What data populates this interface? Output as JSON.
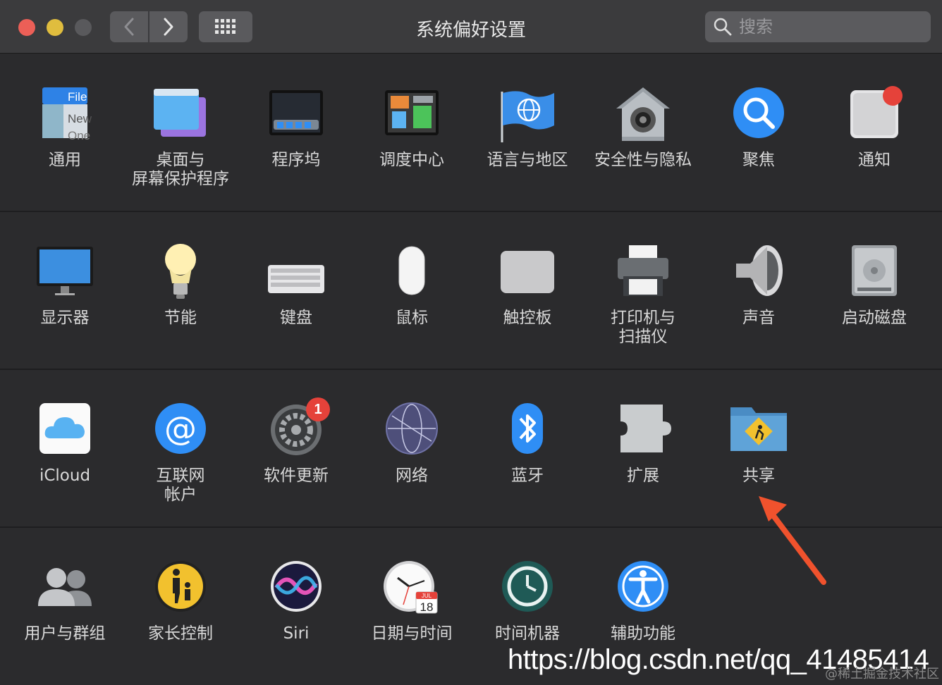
{
  "window": {
    "title": "系统偏好设置"
  },
  "search": {
    "placeholder": "搜索"
  },
  "rows": [
    [
      {
        "label": "通用",
        "icon": "general-icon"
      },
      {
        "label": "桌面与\n屏幕保护程序",
        "icon": "desktop-screensaver-icon"
      },
      {
        "label": "程序坞",
        "icon": "dock-icon"
      },
      {
        "label": "调度中心",
        "icon": "mission-control-icon"
      },
      {
        "label": "语言与地区",
        "icon": "language-region-icon"
      },
      {
        "label": "安全性与隐私",
        "icon": "security-privacy-icon"
      },
      {
        "label": "聚焦",
        "icon": "spotlight-icon"
      },
      {
        "label": "通知",
        "icon": "notifications-icon"
      }
    ],
    [
      {
        "label": "显示器",
        "icon": "displays-icon"
      },
      {
        "label": "节能",
        "icon": "energy-saver-icon"
      },
      {
        "label": "键盘",
        "icon": "keyboard-icon"
      },
      {
        "label": "鼠标",
        "icon": "mouse-icon"
      },
      {
        "label": "触控板",
        "icon": "trackpad-icon"
      },
      {
        "label": "打印机与\n扫描仪",
        "icon": "printers-scanners-icon"
      },
      {
        "label": "声音",
        "icon": "sound-icon"
      },
      {
        "label": "启动磁盘",
        "icon": "startup-disk-icon"
      }
    ],
    [
      {
        "label": "iCloud",
        "icon": "icloud-icon"
      },
      {
        "label": "互联网\n帐户",
        "icon": "internet-accounts-icon"
      },
      {
        "label": "软件更新",
        "icon": "software-update-icon",
        "badge": "1"
      },
      {
        "label": "网络",
        "icon": "network-icon"
      },
      {
        "label": "蓝牙",
        "icon": "bluetooth-icon"
      },
      {
        "label": "扩展",
        "icon": "extensions-icon"
      },
      {
        "label": "共享",
        "icon": "sharing-icon"
      }
    ],
    [
      {
        "label": "用户与群组",
        "icon": "users-groups-icon"
      },
      {
        "label": "家长控制",
        "icon": "parental-controls-icon"
      },
      {
        "label": "Siri",
        "icon": "siri-icon"
      },
      {
        "label": "日期与时间",
        "icon": "date-time-icon"
      },
      {
        "label": "时间机器",
        "icon": "time-machine-icon"
      },
      {
        "label": "辅助功能",
        "icon": "accessibility-icon"
      }
    ]
  ],
  "icon_texts": {
    "general_file": "File",
    "general_new": "New",
    "general_one": "One",
    "calendar_month": "JUL",
    "calendar_day": "18"
  },
  "watermark": {
    "url": "https://blog.csdn.net/qq_41485414",
    "sub": "@稀土掘金技术社区"
  },
  "colors": {
    "accent_blue": "#2f8ef5",
    "badge_red": "#e5423a",
    "arrow": "#f0522d"
  }
}
